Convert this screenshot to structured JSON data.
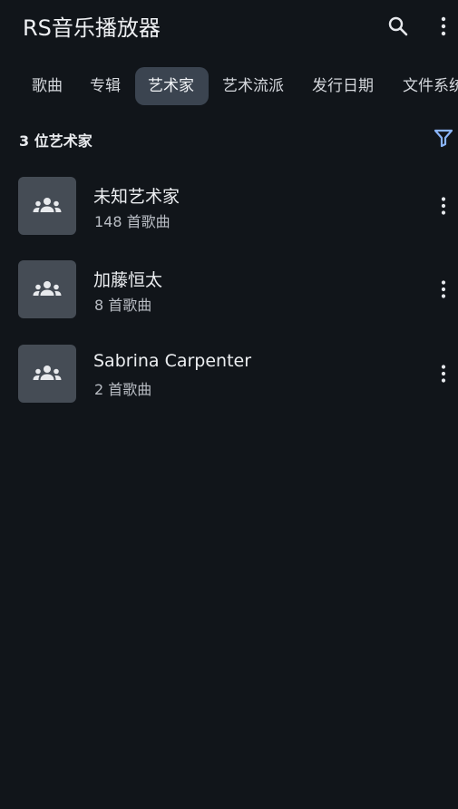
{
  "header": {
    "title": "RS音乐播放器",
    "icons": [
      "search-icon",
      "more-vert-icon"
    ]
  },
  "tabs": [
    {
      "label": "歌曲",
      "active": false
    },
    {
      "label": "专辑",
      "active": false
    },
    {
      "label": "艺术家",
      "active": true
    },
    {
      "label": "艺术流派",
      "active": false
    },
    {
      "label": "发行日期",
      "active": false
    },
    {
      "label": "文件系统",
      "active": false
    }
  ],
  "summary": {
    "count_label": "3 位艺术家",
    "filter_icon": "filter-icon"
  },
  "artists": [
    {
      "name": "未知艺术家",
      "songs": "148 首歌曲",
      "icon": "people-group-icon"
    },
    {
      "name": "加藤恒太",
      "songs": "8 首歌曲",
      "icon": "people-group-icon"
    },
    {
      "name": "Sabrina Carpenter",
      "songs": "2 首歌曲",
      "icon": "people-group-icon"
    }
  ],
  "colors": {
    "background": "#11151a",
    "active_tab": "#3b4450",
    "thumb": "#454c55",
    "accent": "#8ab4f8"
  }
}
